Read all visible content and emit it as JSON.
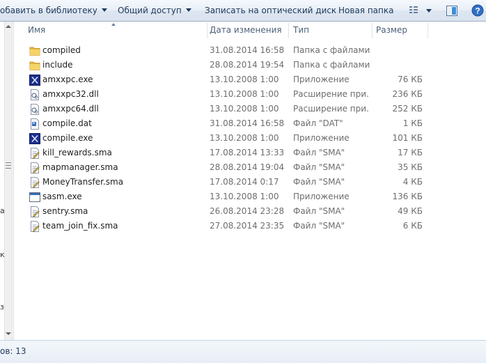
{
  "toolbar": {
    "library_label": "обавить в библиотеку",
    "share_label": "Общий доступ",
    "burn_label": "Записать на оптический диск",
    "new_folder_label": "Новая папка"
  },
  "columns": {
    "name": "Имя",
    "date": "Дата изменения",
    "type": "Тип",
    "size": "Размер"
  },
  "nav_stubs": [
    "а",
    "к",
    "з"
  ],
  "files": [
    {
      "name": "compiled",
      "date": "31.08.2014 16:58",
      "type": "Папка с файлами",
      "size": "",
      "icon": "folder-icon"
    },
    {
      "name": "include",
      "date": "28.08.2014 19:54",
      "type": "Папка с файлами",
      "size": "",
      "icon": "folder-icon"
    },
    {
      "name": "amxxpc.exe",
      "date": "13.10.2008 1:00",
      "type": "Приложение",
      "size": "76 КБ",
      "icon": "exe-icon"
    },
    {
      "name": "amxxpc32.dll",
      "date": "13.10.2008 1:00",
      "type": "Расширение при...",
      "size": "236 КБ",
      "icon": "dll-icon"
    },
    {
      "name": "amxxpc64.dll",
      "date": "13.10.2008 1:00",
      "type": "Расширение при...",
      "size": "252 КБ",
      "icon": "dll-icon"
    },
    {
      "name": "compile.dat",
      "date": "31.08.2014 16:58",
      "type": "Файл \"DAT\"",
      "size": "1 КБ",
      "icon": "dat-icon"
    },
    {
      "name": "compile.exe",
      "date": "13.10.2008 1:00",
      "type": "Приложение",
      "size": "101 КБ",
      "icon": "exe-icon"
    },
    {
      "name": "kill_rewards.sma",
      "date": "17.08.2014 13:33",
      "type": "Файл \"SMA\"",
      "size": "17 КБ",
      "icon": "sma-icon"
    },
    {
      "name": "mapmanager.sma",
      "date": "28.08.2014 19:04",
      "type": "Файл \"SMA\"",
      "size": "35 КБ",
      "icon": "sma-icon"
    },
    {
      "name": "MoneyTransfer.sma",
      "date": "17.08.2014 0:17",
      "type": "Файл \"SMA\"",
      "size": "4 КБ",
      "icon": "sma-icon"
    },
    {
      "name": "sasm.exe",
      "date": "13.10.2008 1:00",
      "type": "Приложение",
      "size": "136 КБ",
      "icon": "window-exe-icon"
    },
    {
      "name": "sentry.sma",
      "date": "26.08.2014 23:28",
      "type": "Файл \"SMA\"",
      "size": "49 КБ",
      "icon": "sma-icon"
    },
    {
      "name": "team_join_fix.sma",
      "date": "27.08.2014 23:35",
      "type": "Файл \"SMA\"",
      "size": "6 КБ",
      "icon": "sma-icon"
    }
  ],
  "status": {
    "text": "ов: 13"
  }
}
